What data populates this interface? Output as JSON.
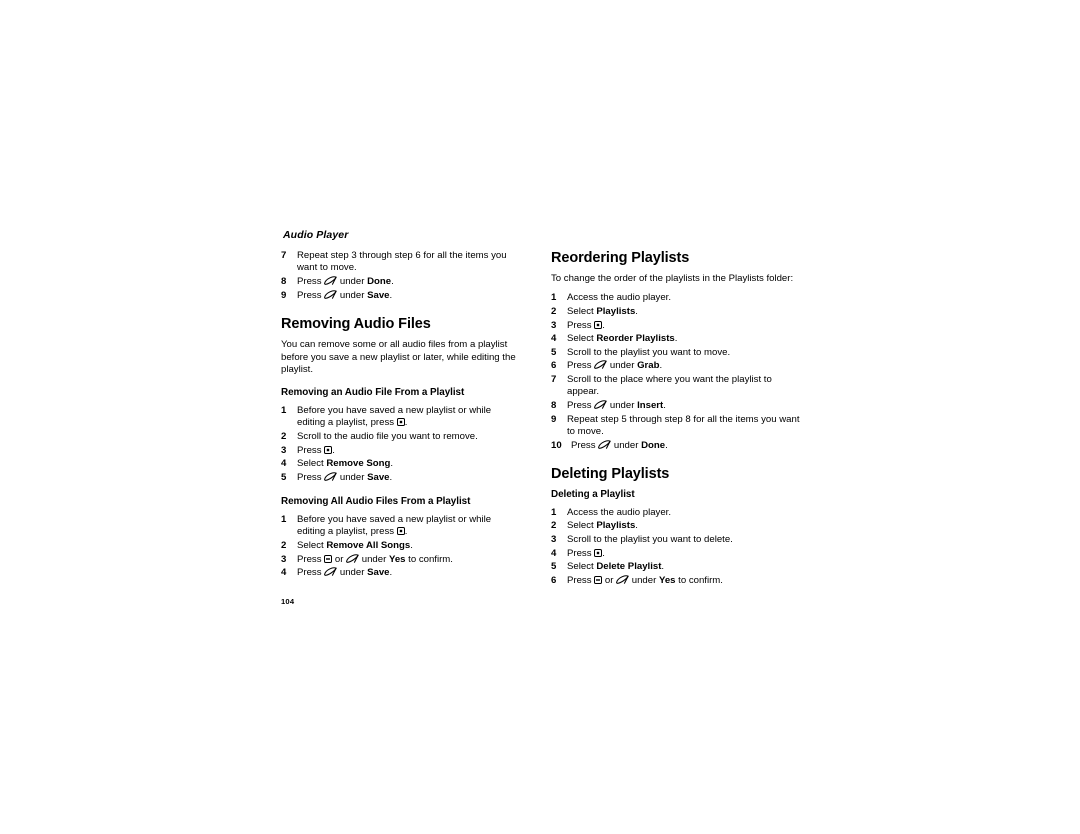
{
  "page": {
    "running_head": "Audio Player",
    "folio": "104",
    "background_color": "#ffffff",
    "text_color": "#000000"
  },
  "glyphs": {
    "softkey": {
      "name": "softkey-glyph",
      "description": "slanted lens shaped soft key icon"
    },
    "menu": {
      "name": "menu-key-glyph",
      "description": "square key with centered dot"
    },
    "minus": {
      "name": "minus-key-glyph",
      "description": "square key with horizontal bar"
    }
  },
  "left_column": {
    "continued_steps": {
      "name": "moving-audio-files-steps-continued",
      "items": [
        {
          "num": "7",
          "parts": [
            {
              "t": "text",
              "v": "Repeat step 3 through step 6 for all the items you want to move."
            }
          ]
        },
        {
          "num": "8",
          "parts": [
            {
              "t": "text",
              "v": "Press "
            },
            {
              "t": "glyph",
              "v": "softkey"
            },
            {
              "t": "text",
              "v": " under "
            },
            {
              "t": "bold",
              "v": "Done"
            },
            {
              "t": "text",
              "v": "."
            }
          ]
        },
        {
          "num": "9",
          "parts": [
            {
              "t": "text",
              "v": "Press "
            },
            {
              "t": "glyph",
              "v": "softkey"
            },
            {
              "t": "text",
              "v": " under "
            },
            {
              "t": "bold",
              "v": "Save"
            },
            {
              "t": "text",
              "v": "."
            }
          ]
        }
      ]
    },
    "section": {
      "heading": "Removing Audio Files",
      "intro": "You can remove some or all audio files from a playlist before you save a new playlist or later, while editing the playlist.",
      "subsections": [
        {
          "heading": "Removing an Audio File From a Playlist",
          "steps": [
            {
              "num": "1",
              "parts": [
                {
                  "t": "text",
                  "v": "Before you have saved a new playlist or while editing a playlist, press "
                },
                {
                  "t": "glyph",
                  "v": "menu"
                },
                {
                  "t": "text",
                  "v": "."
                }
              ]
            },
            {
              "num": "2",
              "parts": [
                {
                  "t": "text",
                  "v": "Scroll to the audio file you want to remove."
                }
              ]
            },
            {
              "num": "3",
              "parts": [
                {
                  "t": "text",
                  "v": "Press "
                },
                {
                  "t": "glyph",
                  "v": "menu"
                },
                {
                  "t": "text",
                  "v": "."
                }
              ]
            },
            {
              "num": "4",
              "parts": [
                {
                  "t": "text",
                  "v": "Select "
                },
                {
                  "t": "bold",
                  "v": "Remove Song"
                },
                {
                  "t": "text",
                  "v": "."
                }
              ]
            },
            {
              "num": "5",
              "parts": [
                {
                  "t": "text",
                  "v": "Press "
                },
                {
                  "t": "glyph",
                  "v": "softkey"
                },
                {
                  "t": "text",
                  "v": " under "
                },
                {
                  "t": "bold",
                  "v": "Save"
                },
                {
                  "t": "text",
                  "v": "."
                }
              ]
            }
          ]
        },
        {
          "heading": "Removing All Audio Files From a Playlist",
          "steps": [
            {
              "num": "1",
              "parts": [
                {
                  "t": "text",
                  "v": "Before you have saved a new playlist or while editing a playlist, press "
                },
                {
                  "t": "glyph",
                  "v": "menu"
                },
                {
                  "t": "text",
                  "v": "."
                }
              ]
            },
            {
              "num": "2",
              "parts": [
                {
                  "t": "text",
                  "v": "Select "
                },
                {
                  "t": "bold",
                  "v": "Remove All Songs"
                },
                {
                  "t": "text",
                  "v": "."
                }
              ]
            },
            {
              "num": "3",
              "parts": [
                {
                  "t": "text",
                  "v": "Press "
                },
                {
                  "t": "glyph",
                  "v": "minus"
                },
                {
                  "t": "text",
                  "v": " or "
                },
                {
                  "t": "glyph",
                  "v": "softkey"
                },
                {
                  "t": "text",
                  "v": " under "
                },
                {
                  "t": "bold",
                  "v": "Yes"
                },
                {
                  "t": "text",
                  "v": " to confirm."
                }
              ]
            },
            {
              "num": "4",
              "parts": [
                {
                  "t": "text",
                  "v": "Press "
                },
                {
                  "t": "glyph",
                  "v": "softkey"
                },
                {
                  "t": "text",
                  "v": " under "
                },
                {
                  "t": "bold",
                  "v": "Save"
                },
                {
                  "t": "text",
                  "v": "."
                }
              ]
            }
          ]
        }
      ]
    }
  },
  "right_column": {
    "sections": [
      {
        "heading": "Reordering Playlists",
        "intro": "To change the order of the playlists in the Playlists folder:",
        "steps": [
          {
            "num": "1",
            "parts": [
              {
                "t": "text",
                "v": "Access the audio player."
              }
            ]
          },
          {
            "num": "2",
            "parts": [
              {
                "t": "text",
                "v": "Select "
              },
              {
                "t": "bold",
                "v": "Playlists"
              },
              {
                "t": "text",
                "v": "."
              }
            ]
          },
          {
            "num": "3",
            "parts": [
              {
                "t": "text",
                "v": "Press "
              },
              {
                "t": "glyph",
                "v": "menu"
              },
              {
                "t": "text",
                "v": "."
              }
            ]
          },
          {
            "num": "4",
            "parts": [
              {
                "t": "text",
                "v": "Select "
              },
              {
                "t": "bold",
                "v": "Reorder Playlists"
              },
              {
                "t": "text",
                "v": "."
              }
            ]
          },
          {
            "num": "5",
            "parts": [
              {
                "t": "text",
                "v": "Scroll to the playlist you want to move."
              }
            ]
          },
          {
            "num": "6",
            "parts": [
              {
                "t": "text",
                "v": "Press "
              },
              {
                "t": "glyph",
                "v": "softkey"
              },
              {
                "t": "text",
                "v": " under "
              },
              {
                "t": "bold",
                "v": "Grab"
              },
              {
                "t": "text",
                "v": "."
              }
            ]
          },
          {
            "num": "7",
            "parts": [
              {
                "t": "text",
                "v": "Scroll to the place where you want the playlist to appear."
              }
            ]
          },
          {
            "num": "8",
            "parts": [
              {
                "t": "text",
                "v": "Press "
              },
              {
                "t": "glyph",
                "v": "softkey"
              },
              {
                "t": "text",
                "v": " under "
              },
              {
                "t": "bold",
                "v": "Insert"
              },
              {
                "t": "text",
                "v": "."
              }
            ]
          },
          {
            "num": "9",
            "parts": [
              {
                "t": "text",
                "v": "Repeat step 5 through step 8 for all the items you want to move."
              }
            ]
          },
          {
            "num": "10",
            "wide": true,
            "parts": [
              {
                "t": "text",
                "v": "Press "
              },
              {
                "t": "glyph",
                "v": "softkey"
              },
              {
                "t": "text",
                "v": " under "
              },
              {
                "t": "bold",
                "v": "Done"
              },
              {
                "t": "text",
                "v": "."
              }
            ]
          }
        ]
      }
    ],
    "deleting": {
      "heading": "Deleting Playlists",
      "subheading": "Deleting a Playlist",
      "steps": [
        {
          "num": "1",
          "parts": [
            {
              "t": "text",
              "v": "Access the audio player."
            }
          ]
        },
        {
          "num": "2",
          "parts": [
            {
              "t": "text",
              "v": "Select "
            },
            {
              "t": "bold",
              "v": "Playlists"
            },
            {
              "t": "text",
              "v": "."
            }
          ]
        },
        {
          "num": "3",
          "parts": [
            {
              "t": "text",
              "v": "Scroll to the playlist you want to delete."
            }
          ]
        },
        {
          "num": "4",
          "parts": [
            {
              "t": "text",
              "v": "Press "
            },
            {
              "t": "glyph",
              "v": "menu"
            },
            {
              "t": "text",
              "v": "."
            }
          ]
        },
        {
          "num": "5",
          "parts": [
            {
              "t": "text",
              "v": "Select "
            },
            {
              "t": "bold",
              "v": "Delete Playlist"
            },
            {
              "t": "text",
              "v": "."
            }
          ]
        },
        {
          "num": "6",
          "parts": [
            {
              "t": "text",
              "v": "Press "
            },
            {
              "t": "glyph",
              "v": "minus"
            },
            {
              "t": "text",
              "v": " or "
            },
            {
              "t": "glyph",
              "v": "softkey"
            },
            {
              "t": "text",
              "v": " under "
            },
            {
              "t": "bold",
              "v": "Yes"
            },
            {
              "t": "text",
              "v": " to confirm."
            }
          ]
        }
      ]
    }
  }
}
